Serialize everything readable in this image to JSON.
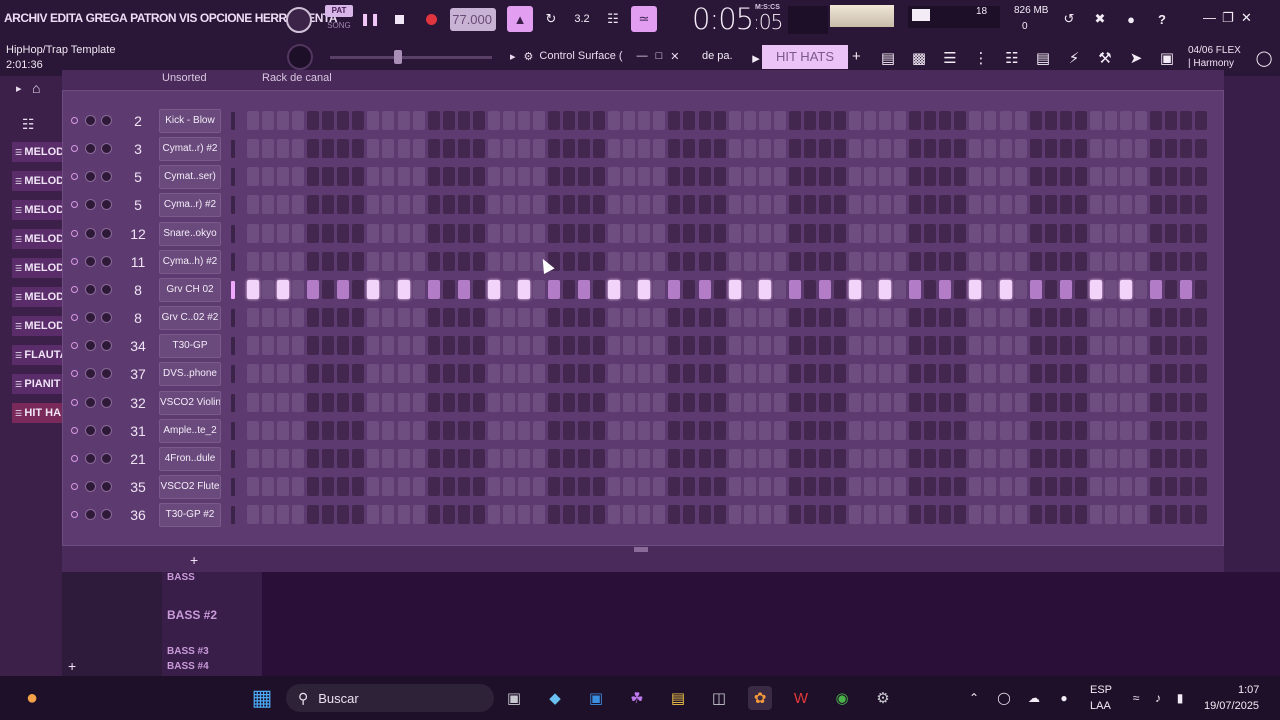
{
  "menu": [
    "ARCHIV",
    "EDITA",
    "GREGA",
    "PATRON",
    "VIS",
    "OPCIONE",
    "HERRAMIENTA"
  ],
  "song": {
    "title": "HipHop/Trap Template",
    "time": "2:01:36"
  },
  "transport": {
    "pat_label": "PAT",
    "song_label": "SONG",
    "tempo": "77.000",
    "clock_main": "0:05",
    "clock_sub": ":05",
    "clock_unit": "M:S:CS"
  },
  "monitor": {
    "cpu": "18",
    "mem": "826 MB",
    "mem_sub": "0"
  },
  "control_surface": "Control Surface (",
  "pattern": {
    "partial_label": "de pa.",
    "name": "HIT HATS"
  },
  "hint": {
    "line1": "04/06  FLEX",
    "line2": "| Harmony"
  },
  "browser": {
    "items": [
      {
        "label": "MELODY",
        "selected": false
      },
      {
        "label": "MELODY",
        "selected": false
      },
      {
        "label": "MELOD",
        "selected": false
      },
      {
        "label": "MELOD",
        "selected": false
      },
      {
        "label": "MELODY",
        "selected": false
      },
      {
        "label": "MELODY",
        "selected": false
      },
      {
        "label": "MELODY",
        "selected": false
      },
      {
        "label": "FLAUTA",
        "selected": false
      },
      {
        "label": "PIANIT",
        "selected": false
      },
      {
        "label": "HIT HA",
        "selected": true
      }
    ]
  },
  "rack": {
    "header_title": "Rack de canal",
    "header_group": "Unsorted",
    "channels": [
      {
        "mixer": "2",
        "name": "Kick - Blow",
        "selected": false,
        "steps_on": []
      },
      {
        "mixer": "3",
        "name": "Cymat..r) #2",
        "selected": false,
        "steps_on": []
      },
      {
        "mixer": "5",
        "name": "Cymat..ser)",
        "selected": false,
        "steps_on": []
      },
      {
        "mixer": "5",
        "name": "Cyma..r) #2",
        "selected": false,
        "steps_on": []
      },
      {
        "mixer": "12",
        "name": "Snare..okyo",
        "selected": false,
        "steps_on": []
      },
      {
        "mixer": "11",
        "name": "Cyma..h) #2",
        "selected": false,
        "steps_on": []
      },
      {
        "mixer": "8",
        "name": "Grv CH 02",
        "selected": true,
        "steps_on": [
          0,
          2,
          4,
          6,
          8,
          10,
          12,
          14,
          16,
          18,
          20,
          22,
          24,
          26,
          28,
          30,
          32,
          34,
          36,
          38,
          40,
          42,
          44,
          46,
          48,
          50,
          52,
          54,
          56,
          58,
          60,
          62
        ]
      },
      {
        "mixer": "8",
        "name": "Grv C..02 #2",
        "selected": false,
        "steps_on": []
      },
      {
        "mixer": "34",
        "name": "T30-GP",
        "selected": false,
        "steps_on": []
      },
      {
        "mixer": "37",
        "name": "DVS..phone",
        "selected": false,
        "steps_on": []
      },
      {
        "mixer": "32",
        "name": "VSCO2 Violin",
        "selected": false,
        "steps_on": []
      },
      {
        "mixer": "31",
        "name": "Ample..te_2",
        "selected": false,
        "steps_on": []
      },
      {
        "mixer": "21",
        "name": "4Fron..dule",
        "selected": false,
        "steps_on": []
      },
      {
        "mixer": "35",
        "name": "VSCO2 Flute",
        "selected": false,
        "steps_on": []
      },
      {
        "mixer": "36",
        "name": "T30-GP #2",
        "selected": false,
        "steps_on": []
      }
    ],
    "step_count": 64
  },
  "playlist": {
    "tracks": [
      "BASS",
      "BASS #2",
      "BASS #3",
      "BASS #4"
    ]
  },
  "taskbar": {
    "search": "Buscar",
    "lang1": "ESP",
    "lang2": "LAA",
    "time": "1:07",
    "date": "19/07/2025"
  }
}
